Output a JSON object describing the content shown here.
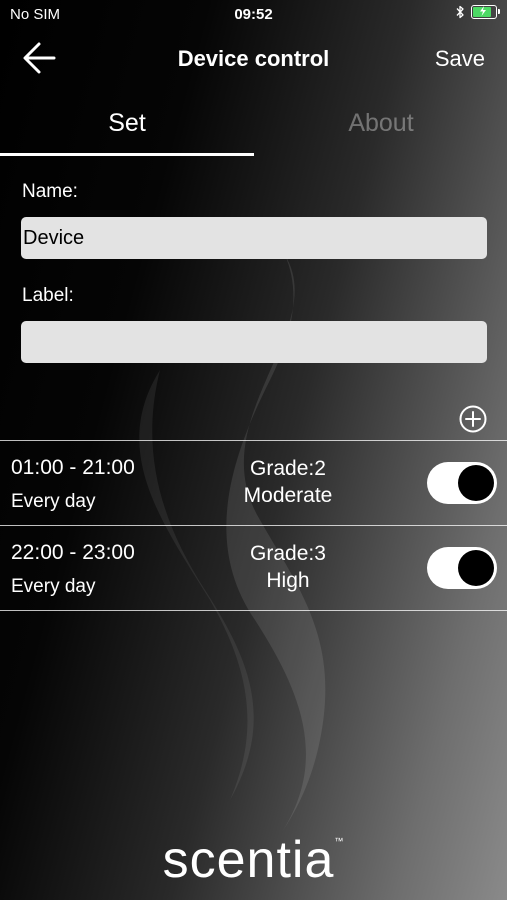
{
  "status_bar": {
    "carrier": "No SIM",
    "time": "09:52",
    "battery_charge": 0.75,
    "battery_color": "#4cd964"
  },
  "nav": {
    "back_icon": "arrow-left-icon",
    "title": "Device control",
    "save_label": "Save"
  },
  "tabs": {
    "set_label": "Set",
    "about_label": "About",
    "active": "Set"
  },
  "form": {
    "name_label": "Name:",
    "name_value": "Device",
    "label_label": "Label:",
    "label_value": ""
  },
  "add_icon": "plus-circle-icon",
  "schedules": [
    {
      "time": "01:00 - 21:00",
      "repeat": "Every day",
      "grade": "Grade:2",
      "level": "Moderate",
      "enabled": true
    },
    {
      "time": "22:00 - 23:00",
      "repeat": "Every day",
      "grade": "Grade:3",
      "level": "High",
      "enabled": true
    }
  ],
  "brand": {
    "logo_text": "scentia",
    "trademark": "™"
  }
}
